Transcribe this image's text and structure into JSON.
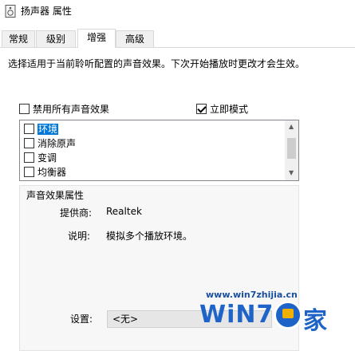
{
  "window": {
    "title": "扬声器 属性"
  },
  "tabs": [
    {
      "label": "常规",
      "active": false
    },
    {
      "label": "级别",
      "active": false
    },
    {
      "label": "增强",
      "active": true
    },
    {
      "label": "高级",
      "active": false
    }
  ],
  "description": "选择适用于当前聆听配置的声音效果。下次开始播放时更改才会生效。",
  "options": {
    "disable_all": {
      "label": "禁用所有声音效果",
      "checked": false
    },
    "immediate_mode": {
      "label": "立即模式",
      "checked": true
    }
  },
  "effects": [
    {
      "label": "环境",
      "checked": false,
      "selected": true
    },
    {
      "label": "消除原声",
      "checked": false,
      "selected": false
    },
    {
      "label": "变调",
      "checked": false,
      "selected": false
    },
    {
      "label": "均衡器",
      "checked": false,
      "selected": false
    }
  ],
  "properties": {
    "group_title": "声音效果属性",
    "provider_label": "提供商:",
    "provider_value": "Realtek",
    "description_label": "说明:",
    "description_value": "模拟多个播放环境。",
    "setting_label": "设置:",
    "setting_value": "<无>"
  },
  "watermark": {
    "url": "www.win7zhijia.cn",
    "logo": "WiN7",
    "suffix": "家"
  }
}
